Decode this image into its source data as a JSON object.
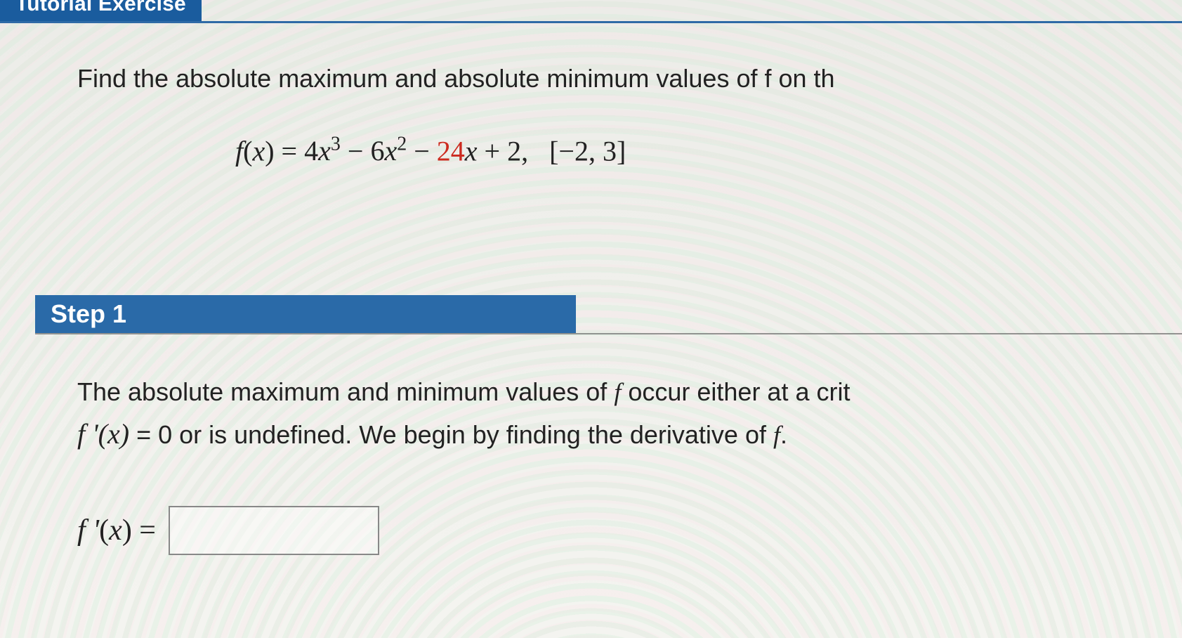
{
  "header": {
    "tab_label": "Tutorial Exercise"
  },
  "problem": {
    "prompt_text": "Find the absolute maximum and absolute minimum values of f on th",
    "fx_label": "f",
    "arg_label": "x",
    "eq_sign": "=",
    "coef_a": "4",
    "coef_b": "6",
    "coef_c": "24",
    "const_term": "2",
    "interval": "[−2, 3]"
  },
  "step": {
    "label": "Step 1",
    "body_line1_a": "The absolute maximum and minimum values of ",
    "body_line1_f": "f",
    "body_line1_b": " occur either at a crit",
    "body_line2_fprime": "f '(x)",
    "body_line2_a": " = 0 or is undefined. We begin by finding the derivative of ",
    "body_line2_f": "f",
    "body_line2_b": ".",
    "answer_label": "f '(x) =",
    "answer_value": ""
  }
}
